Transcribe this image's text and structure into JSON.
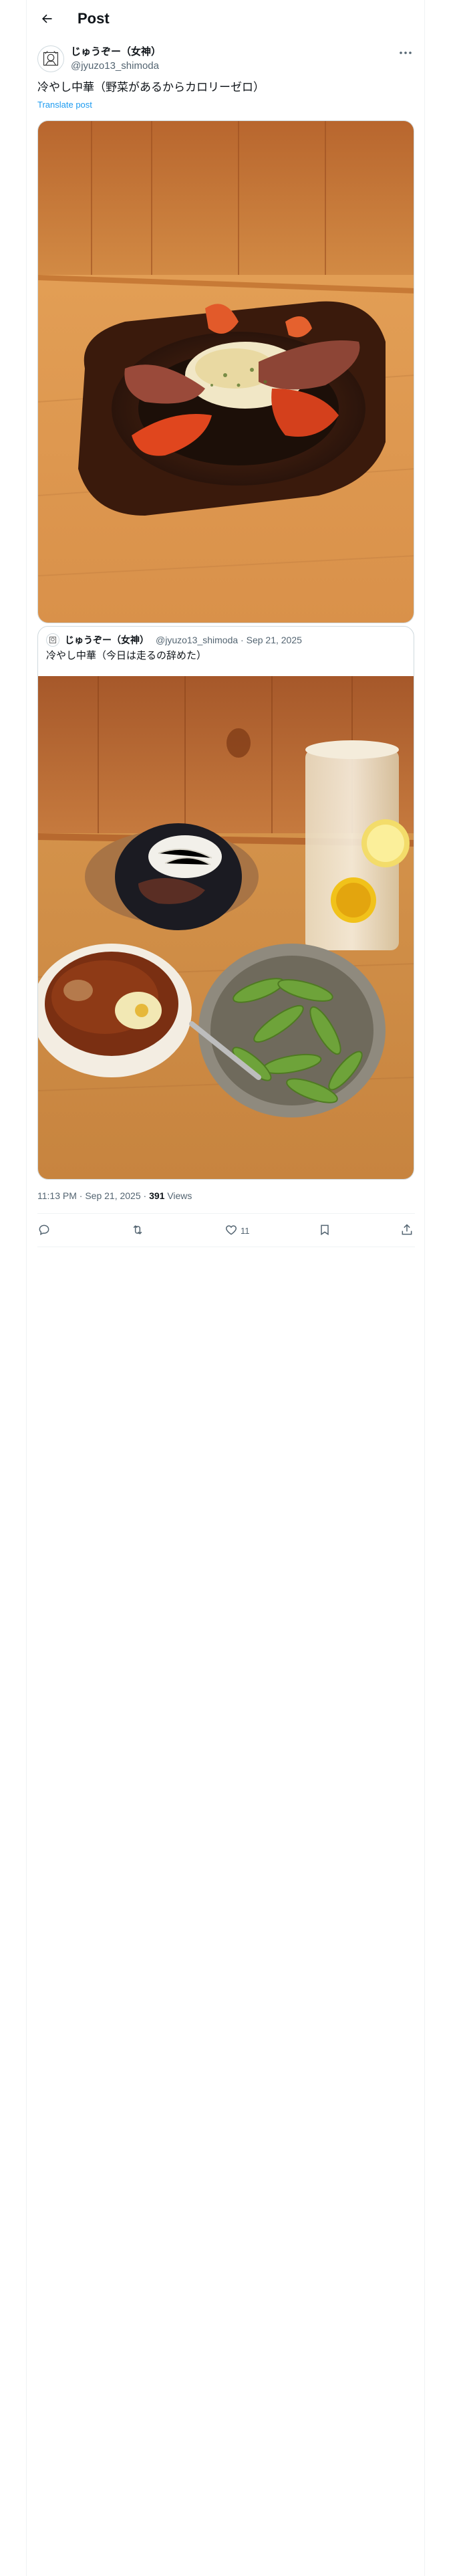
{
  "header": {
    "title": "Post"
  },
  "post": {
    "author_name": "じゅうぞー（女神）",
    "author_handle": "@jyuzo13_shimoda",
    "text": "冷やし中華（野菜があるからカロリーゼロ）",
    "translate_label": "Translate post",
    "timestamp": "11:13 PM · Sep 21, 2025 · ",
    "views_count": "391",
    "views_label": " Views"
  },
  "quote": {
    "author_name": "じゅうぞー（女神）",
    "author_handle": "@jyuzo13_shimoda · Sep 21, 2025",
    "text": "冷やし中華（今日は走るの辞めた）"
  },
  "actions": {
    "reply_count": "",
    "repost_count": "",
    "like_count": "11"
  },
  "icons": [
    "back-arrow-icon",
    "more-icon",
    "reply-icon",
    "repost-icon",
    "like-icon",
    "bookmark-icon",
    "share-icon"
  ]
}
